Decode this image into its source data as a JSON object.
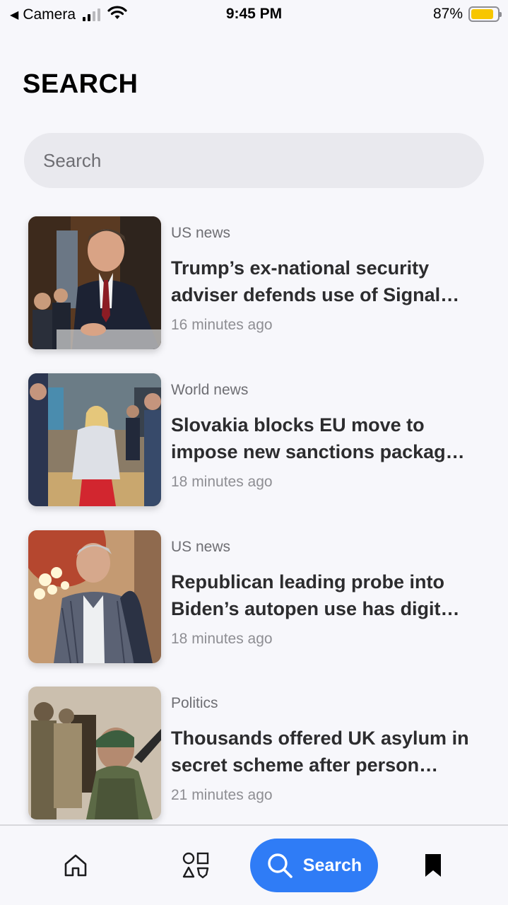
{
  "status_bar": {
    "back_app": "Camera",
    "time": "9:45 PM",
    "battery": "87%",
    "battery_level": 0.87,
    "battery_color": "#f7c600"
  },
  "page": {
    "title": "SEARCH"
  },
  "search": {
    "placeholder": "Search",
    "value": ""
  },
  "articles": [
    {
      "category": "US news",
      "headline": "Trump’s ex-national security adviser defends use of Signal…",
      "time": "16 minutes ago",
      "image": "man-in-suit-at-hearing"
    },
    {
      "category": "World news",
      "headline": "Slovakia blocks EU move to impose new sanctions packag…",
      "time": "18 minutes ago",
      "image": "eu-meeting-room"
    },
    {
      "category": "US news",
      "headline": "Republican leading probe into Biden’s autopen use has digit…",
      "time": "18 minutes ago",
      "image": "man-in-plaid-jacket"
    },
    {
      "category": "Politics",
      "headline": "Thousands offered UK asylum in secret scheme after person…",
      "time": "21 minutes ago",
      "image": "soldiers"
    }
  ],
  "tabbar": {
    "items": [
      {
        "name": "home",
        "icon": "home-icon"
      },
      {
        "name": "categories",
        "icon": "shapes-icon"
      },
      {
        "name": "search",
        "icon": "search-icon",
        "label": "Search",
        "active": true
      },
      {
        "name": "saved",
        "icon": "bookmark-icon"
      }
    ],
    "active_color": "#2f7cf6"
  }
}
